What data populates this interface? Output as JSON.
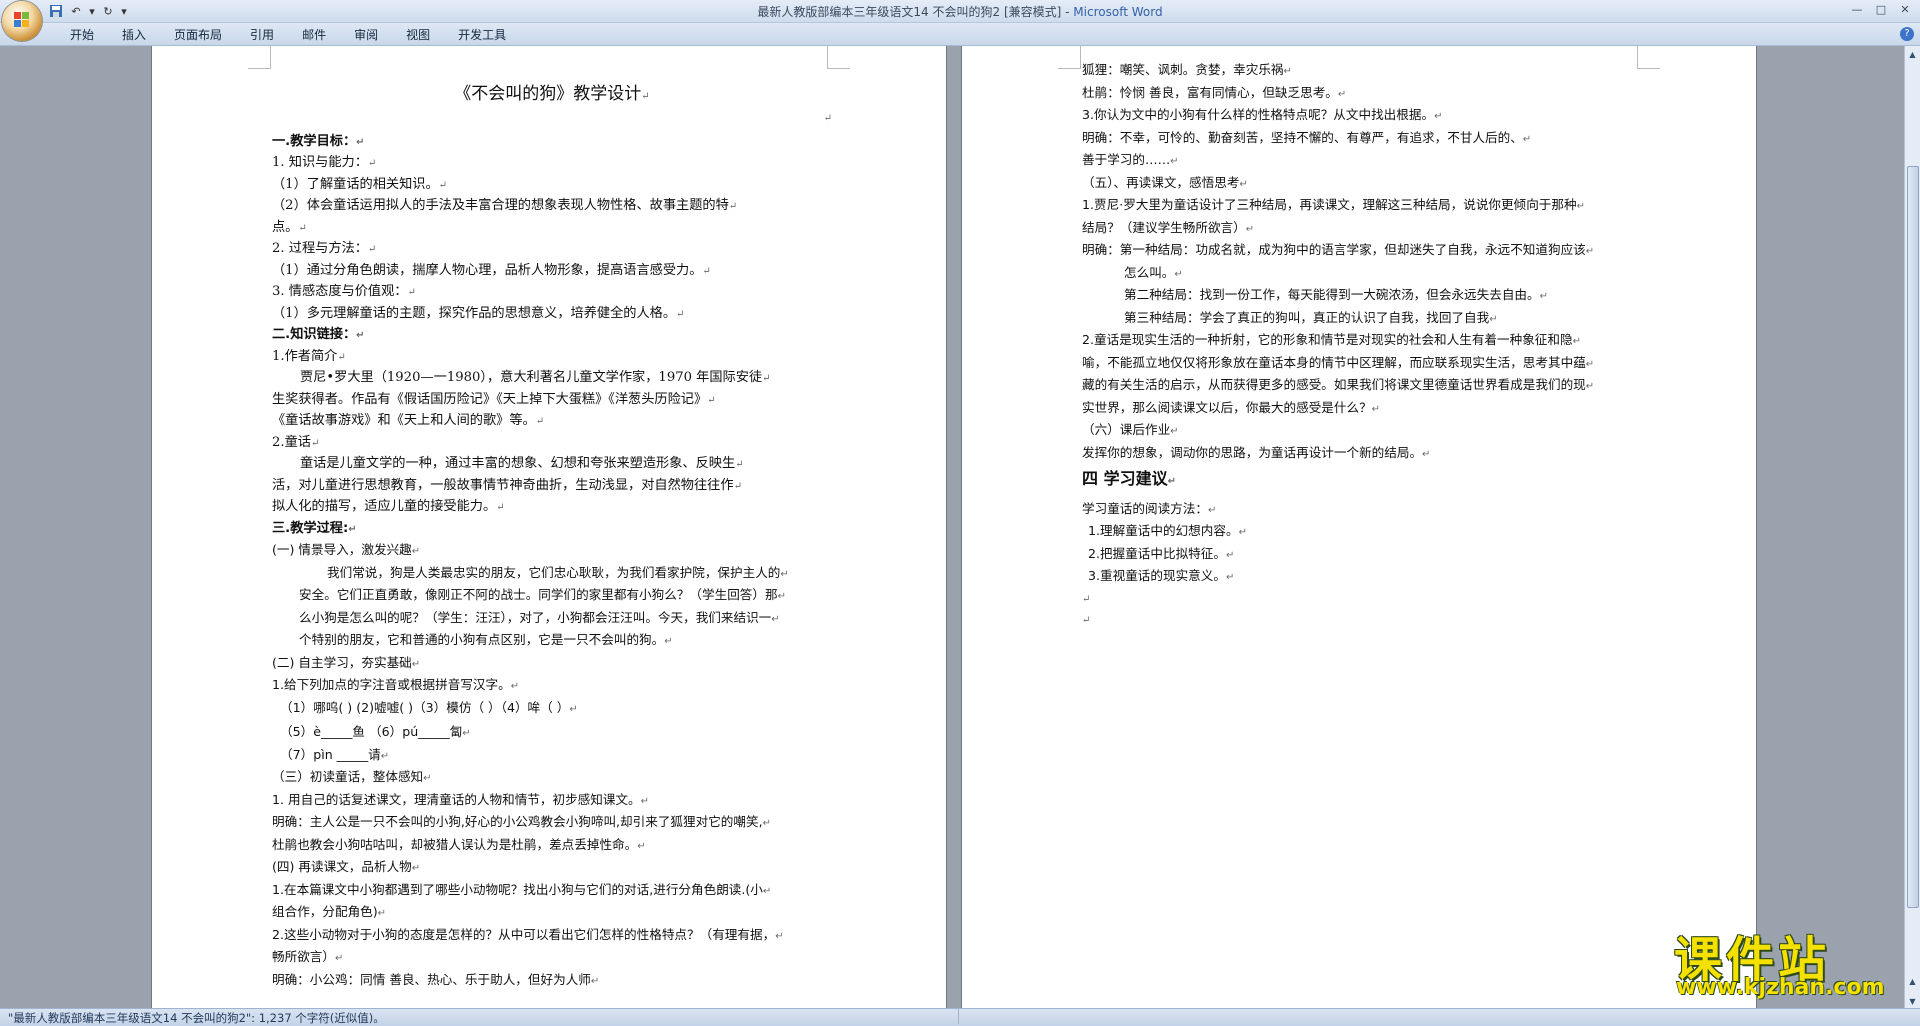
{
  "window": {
    "title_doc": "最新人教版部编本三年级语文14 不会叫的狗2 [兼容模式]",
    "title_sep": " - ",
    "title_app": "Microsoft Word",
    "accent": "#3261a8"
  },
  "ribbon": {
    "tabs": [
      "开始",
      "插入",
      "页面布局",
      "引用",
      "邮件",
      "审阅",
      "视图",
      "开发工具"
    ]
  },
  "left_page": {
    "title": "《不会叫的狗》教学设计",
    "lines": [
      "一.教学目标：",
      "1.   知识与能力：",
      "（1）了解童话的相关知识。",
      "（2）体会童话运用拟人的手法及丰富合理的想象表现人物性格、故事主题的特",
      "点。",
      "2.   过程与方法：",
      "（1）通过分角色朗读，揣摩人物心理，品析人物形象，提高语言感受力。",
      "3.   情感态度与价值观：",
      "（1）多元理解童话的主题，探究作品的思想意义，培养健全的人格。",
      "二.知识链接：",
      "1.作者简介",
      "贾尼•罗大里（1920—一1980），意大利著名儿童文学作家，1970 年国际安徒",
      "生奖获得者。作品有《假话国历险记》《天上掉下大蛋糕》《洋葱头历险记》",
      "《童话故事游戏》和《天上和人间的歌》等。",
      "2.童话",
      "童话是儿童文学的一种，通过丰富的想象、幻想和夸张来塑造形象、反映生",
      "活，对儿童进行思想教育，一般故事情节神奇曲折，生动浅显，对自然物往往作",
      "拟人化的描写，适应儿童的接受能力。",
      "三.教学过程:",
      "(一) 情景导入，激发兴趣",
      "我们常说，狗是人类最忠实的朋友，它们忠心耿耿，为我们看家护院，保护主人的",
      "安全。它们正直勇敢，像刚正不阿的战士。同学们的家里都有小狗么？（学生回答）那",
      "么小狗是怎么叫的呢？（学生：汪汪），对了，小狗都会汪汪叫。今天，我们来结识一",
      "个特别的朋友，它和普通的小狗有点区别，它是一只不会叫的狗。",
      "(二) 自主学习，夯实基础",
      "1.给下列加点的字注音或根据拼音写汉字。",
      "（1）哪呜(    )  (2)嘘嘘(     )（3）模仿（    ）（4）哞（        ）",
      "（5）è_____鱼   （6）pú_____匐",
      "（7）pìn _____请",
      "（三）初读童话，整体感知",
      "1.  用自己的话复述课文，理清童话的人物和情节，初步感知课文。",
      "明确：主人公是一只不会叫的小狗,好心的小公鸡教会小狗啼叫,却引来了狐狸对它的嘲笑,",
      "杜鹃也教会小狗咕咕叫，却被猎人误认为是杜鹃，差点丢掉性命。",
      "(四) 再读课文，品析人物",
      "1.在本篇课文中小狗都遇到了哪些小动物呢？找出小狗与它们的对话,进行分角色朗读.(小",
      "组合作，分配角色)",
      "2.这些小动物对于小狗的态度是怎样的？从中可以看出它们怎样的性格特点？（有理有据，",
      "畅所欲言）",
      "明确：小公鸡：同情     善良、热心、乐于助人，但好为人师"
    ]
  },
  "right_page": {
    "lines": [
      "狐狸：嘲笑、讽刺。贪婪，幸灾乐祸",
      "杜鹃：怜悯   善良，富有同情心，但缺乏思考。",
      "3.你认为文中的小狗有什么样的性格特点呢？从文中找出根据。",
      "明确：不幸，可怜的、勤奋刻苦，坚持不懈的、有尊严，有追求，不甘人后的、",
      "善于学习的……",
      "（五）、再读课文，感悟思考",
      "1.贾尼·罗大里为童话设计了三种结局，再读课文，理解这三种结局，说说你更倾向于那种",
      "结局？（建议学生畅所欲言）",
      "明确：第一种结局：功成名就，成为狗中的语言学家，但却迷失了自我，永远不知道狗应该",
      "怎么叫。",
      "第二种结局：找到一份工作，每天能得到一大碗浓汤，但会永远失去自由。",
      "第三种结局：学会了真正的狗叫，真正的认识了自我，找回了自我",
      "2.童话是现实生活的一种折射，它的形象和情节是对现实的社会和人生有着一种象征和隐",
      "喻，不能孤立地仅仅将形象放在童话本身的情节中区理解，而应联系现实生活，思考其中蕴",
      "藏的有关生活的启示，从而获得更多的感受。如果我们将课文里德童话世界看成是我们的现",
      "实世界，那么阅读课文以后，你最大的感受是什么？",
      "（六）课后作业",
      "发挥你的想象，调动你的思路，为童话再设计一个新的结局。",
      "四 学习建议",
      "学习童话的阅读方法：",
      "1.理解童话中的幻想内容。",
      "2.把握童话中比拟特征。",
      "3.重视童话的现实意义。"
    ]
  },
  "status": {
    "text": "\"最新人教版部编本三年级语文14 不会叫的狗2\": 1,237 个字符(近似值)。"
  },
  "watermark": {
    "big": "课件站",
    "small": "www.kjzhan.com",
    "color": "#f5e100"
  }
}
